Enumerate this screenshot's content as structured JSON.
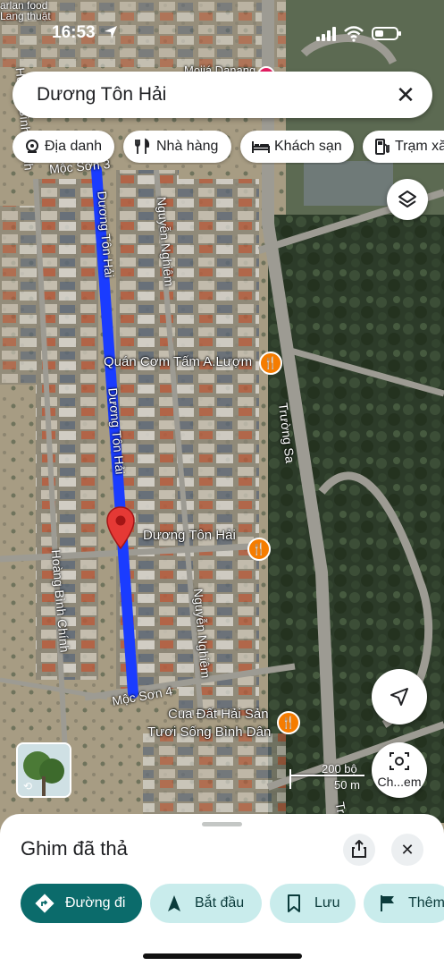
{
  "status_bar": {
    "time": "16:53"
  },
  "search": {
    "value": "Dương Tôn Hải"
  },
  "chips": [
    {
      "label": "Địa danh",
      "icon": "landmark-icon"
    },
    {
      "label": "Nhà hàng",
      "icon": "fork-knife-icon"
    },
    {
      "label": "Khách sạn",
      "icon": "bed-icon"
    },
    {
      "label": "Trạm xă",
      "icon": "fuel-icon"
    }
  ],
  "map": {
    "top_label": "arlan food\nLang thuật",
    "partial_top_label": "Mojiá Danang",
    "streets": {
      "moc_son_3": "Mộc Sơn 3",
      "duong_ton_hai_north": "Dương Tôn Hải",
      "duong_ton_hai_mid": "Dương Tôn Hải",
      "nguyen_nghiem_north": "Nguyễn Nghiêm",
      "nguyen_nghiem_south": "Nguyễn Nghiêm",
      "truong_sa": "Trường Sa",
      "hoang_binh_chinh": "Hoàng Bình Chính",
      "hoang_binh_chinh_top": "Hoàng Bình Chính",
      "moc_son_4": "Mộc Sơn 4",
      "truong_sa_bottom": "Tr"
    },
    "pois": {
      "quan_com_tam": "Quán Cơm Tấm A.Lượm",
      "pin_label": "Dương Tôn Hải",
      "cua_dat_line1": "Cua Đất Hải Sản",
      "cua_dat_line2": "Tươi Sống Bình Dân"
    },
    "scale": {
      "top": "200 bộ",
      "bottom": "50 m"
    },
    "street_view_label": "Ch...em",
    "route_color": "#1a3cff",
    "pin_color": "#e53935",
    "poi_color": "#f57c00"
  },
  "sheet": {
    "title": "Ghim đã thả",
    "actions": [
      {
        "label": "Đường đi",
        "icon": "directions-icon"
      },
      {
        "label": "Bắt đầu",
        "icon": "navigation-arrow-icon"
      },
      {
        "label": "Lưu",
        "icon": "bookmark-icon"
      },
      {
        "label": "Thêm",
        "icon": "flag-icon"
      }
    ]
  }
}
